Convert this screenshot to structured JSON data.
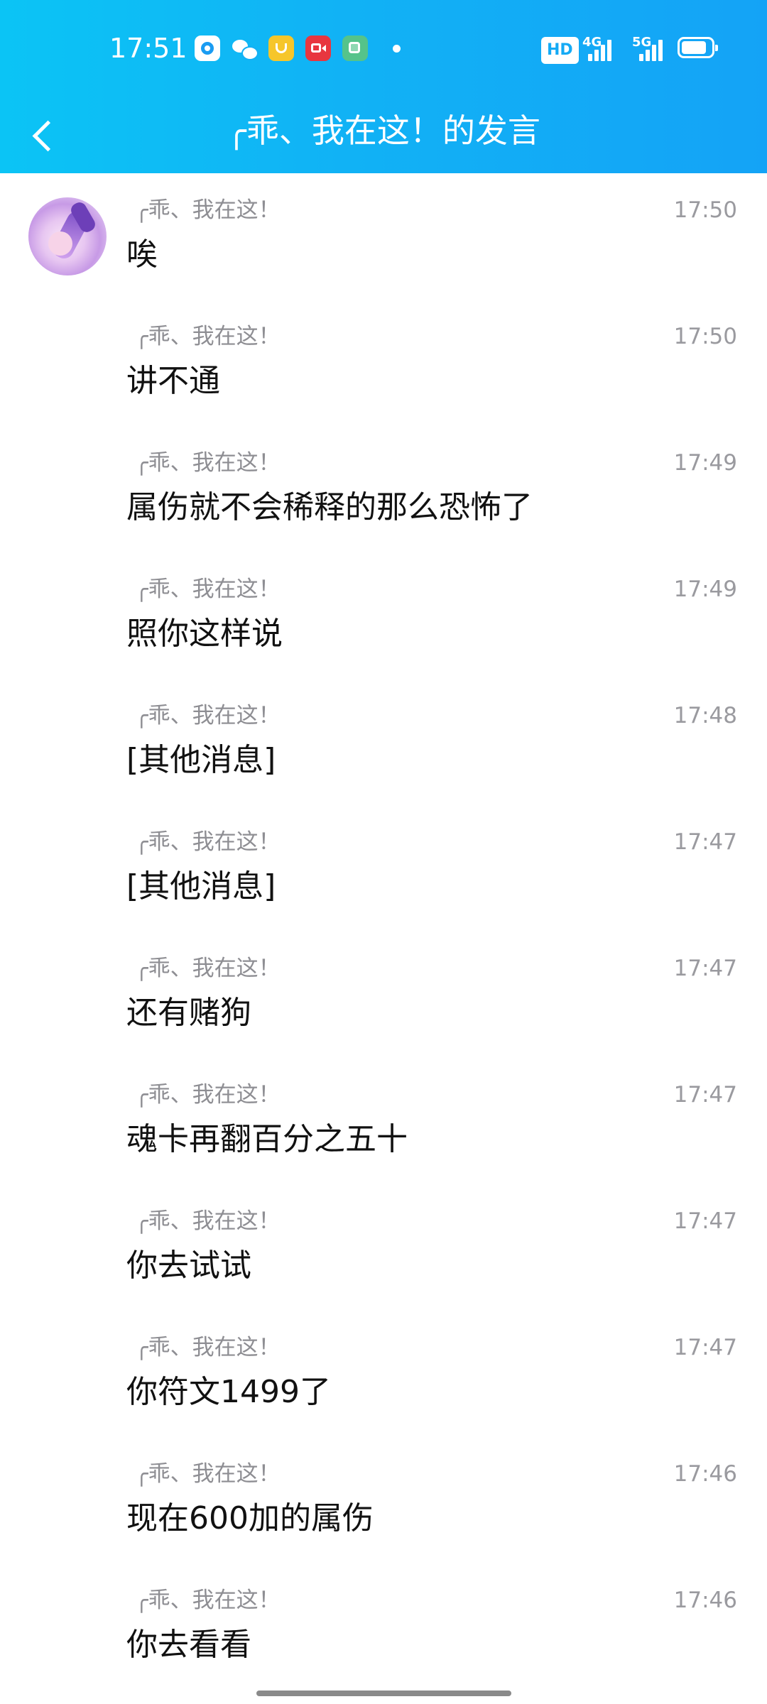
{
  "status_bar": {
    "time": "17:51",
    "notification_icons": [
      "qq-icon",
      "wechat-icon",
      "vip-icon",
      "screen-record-icon",
      "multitask-icon"
    ],
    "hd_label": "HD",
    "signal_1_label": "4G",
    "signal_2_label": "5G",
    "battery_icon": "battery-icon"
  },
  "header": {
    "back_icon": "chevron-left-icon",
    "title": "╭乖、我在这！的发言",
    "background_start": "#0bc4f5",
    "background_end": "#14a3f6"
  },
  "messages": [
    {
      "sender": "╭乖、我在这！",
      "time": "17:50",
      "text": "唉"
    },
    {
      "sender": "╭乖、我在这！",
      "time": "17:50",
      "text": "讲不通"
    },
    {
      "sender": "╭乖、我在这！",
      "time": "17:49",
      "text": "属伤就不会稀释的那么恐怖了"
    },
    {
      "sender": "╭乖、我在这！",
      "time": "17:49",
      "text": "照你这样说"
    },
    {
      "sender": "╭乖、我在这！",
      "time": "17:48",
      "text": "[其他消息]"
    },
    {
      "sender": "╭乖、我在这！",
      "time": "17:47",
      "text": "[其他消息]"
    },
    {
      "sender": "╭乖、我在这！",
      "time": "17:47",
      "text": "还有赌狗"
    },
    {
      "sender": "╭乖、我在这！",
      "time": "17:47",
      "text": "魂卡再翻百分之五十"
    },
    {
      "sender": "╭乖、我在这！",
      "time": "17:47",
      "text": "你去试试"
    },
    {
      "sender": "╭乖、我在这！",
      "time": "17:47",
      "text": "你符文1499了"
    },
    {
      "sender": "╭乖、我在这！",
      "time": "17:46",
      "text": "现在600加的属伤"
    },
    {
      "sender": "╭乖、我在这！",
      "time": "17:46",
      "text": "你去看看"
    }
  ],
  "colors": {
    "sender_text": "#8e8e93",
    "time_text": "#9a9a9f",
    "message_text": "#111111"
  }
}
